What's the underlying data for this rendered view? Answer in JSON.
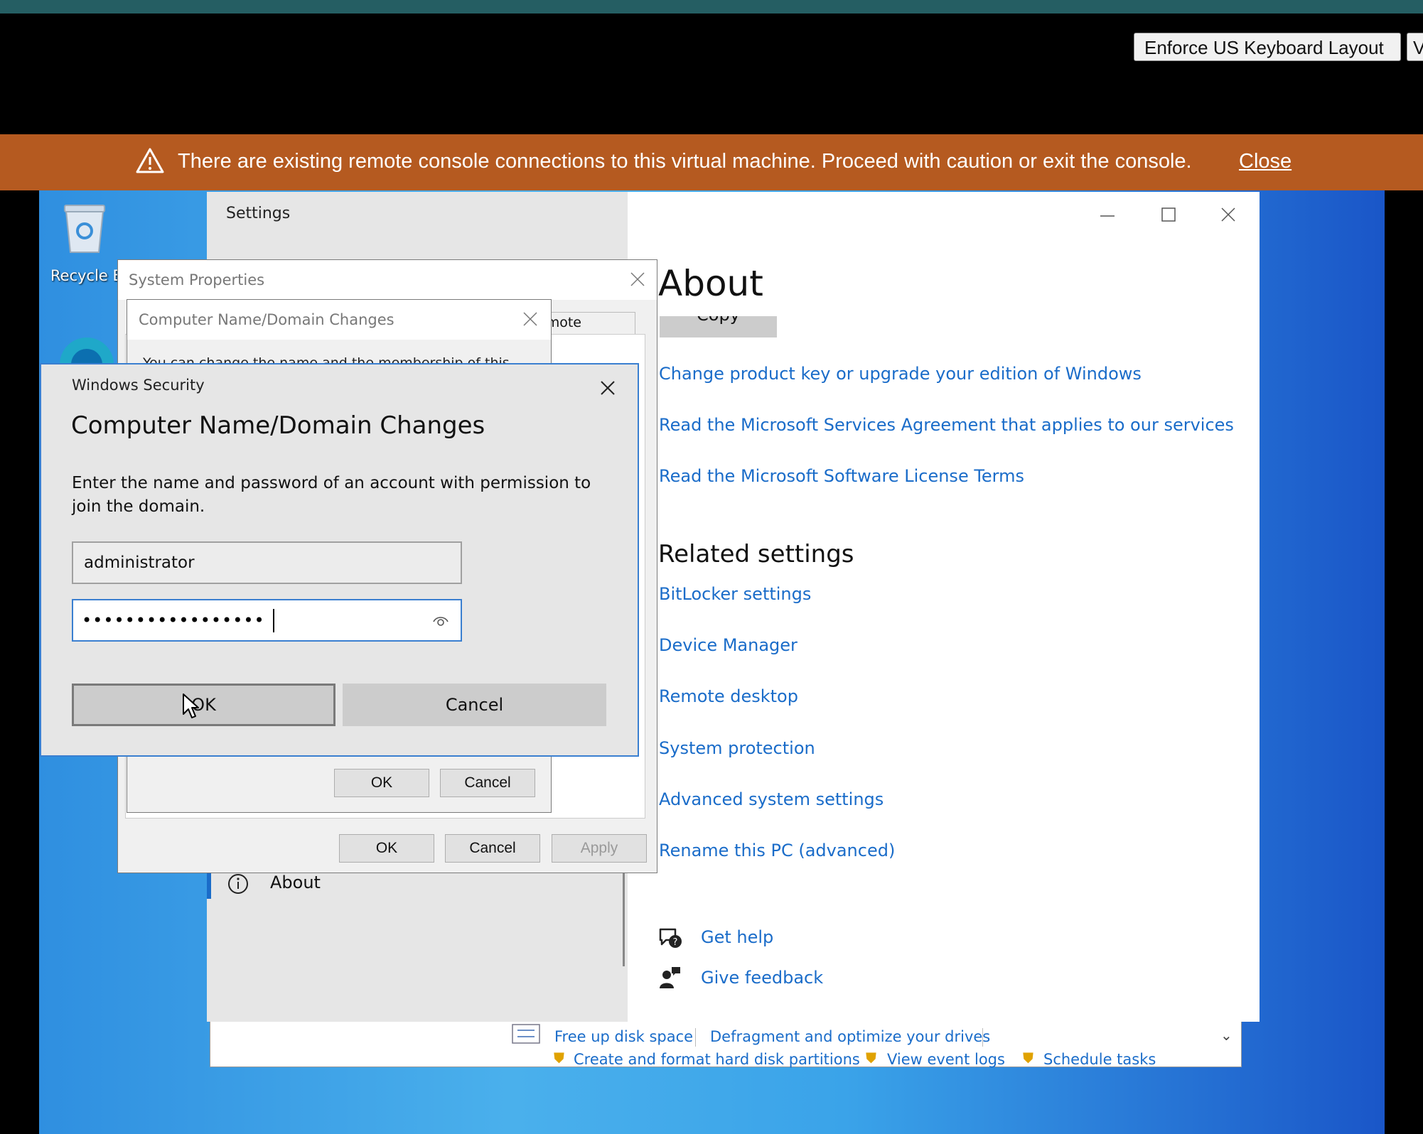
{
  "toolbar": {
    "enforce_label": "Enforce US Keyboard Layout",
    "partial_label": "V"
  },
  "banner": {
    "message": "There are existing remote console connections to this virtual machine. Proceed with caution or exit the console.",
    "close_label": "Close"
  },
  "desktop": {
    "recycle_bin_label": "Recycle B"
  },
  "settings": {
    "title": "Settings",
    "heading": "About",
    "copy_label": "Copy",
    "links": [
      "Change product key or upgrade your edition of Windows",
      "Read the Microsoft Services Agreement that applies to our services",
      "Read the Microsoft Software License Terms"
    ],
    "related_heading": "Related settings",
    "related_links": [
      "BitLocker settings",
      "Device Manager",
      "Remote desktop",
      "System protection",
      "Advanced system settings",
      "Rename this PC (advanced)"
    ],
    "help_label": "Get help",
    "feedback_label": "Give feedback",
    "nav_about": "About"
  },
  "control_panel": {
    "links_row1": [
      "Free up disk space",
      "Defragment and optimize your drives"
    ],
    "links_row2": [
      "Create and format hard disk partitions",
      "View event logs",
      "Schedule tasks"
    ]
  },
  "system_properties": {
    "title": "System Properties",
    "tab_partial": "emote",
    "ok_label": "OK",
    "cancel_label": "Cancel",
    "apply_label": "Apply"
  },
  "computer_name": {
    "title": "Computer Name/Domain Changes",
    "text_partial": "You can change the name and the membership of this",
    "ok_label": "OK",
    "cancel_label": "Cancel"
  },
  "windows_security": {
    "title": "Windows Security",
    "heading": "Computer Name/Domain Changes",
    "description": "Enter the name and password of an account with permission to join the domain.",
    "username_value": "administrator",
    "password_value": "•••••••••••••••••",
    "ok_label": "OK",
    "cancel_label": "Cancel"
  },
  "colors": {
    "banner": "#b55a20",
    "link": "#1a6cc9",
    "top_strip": "#255e63"
  }
}
